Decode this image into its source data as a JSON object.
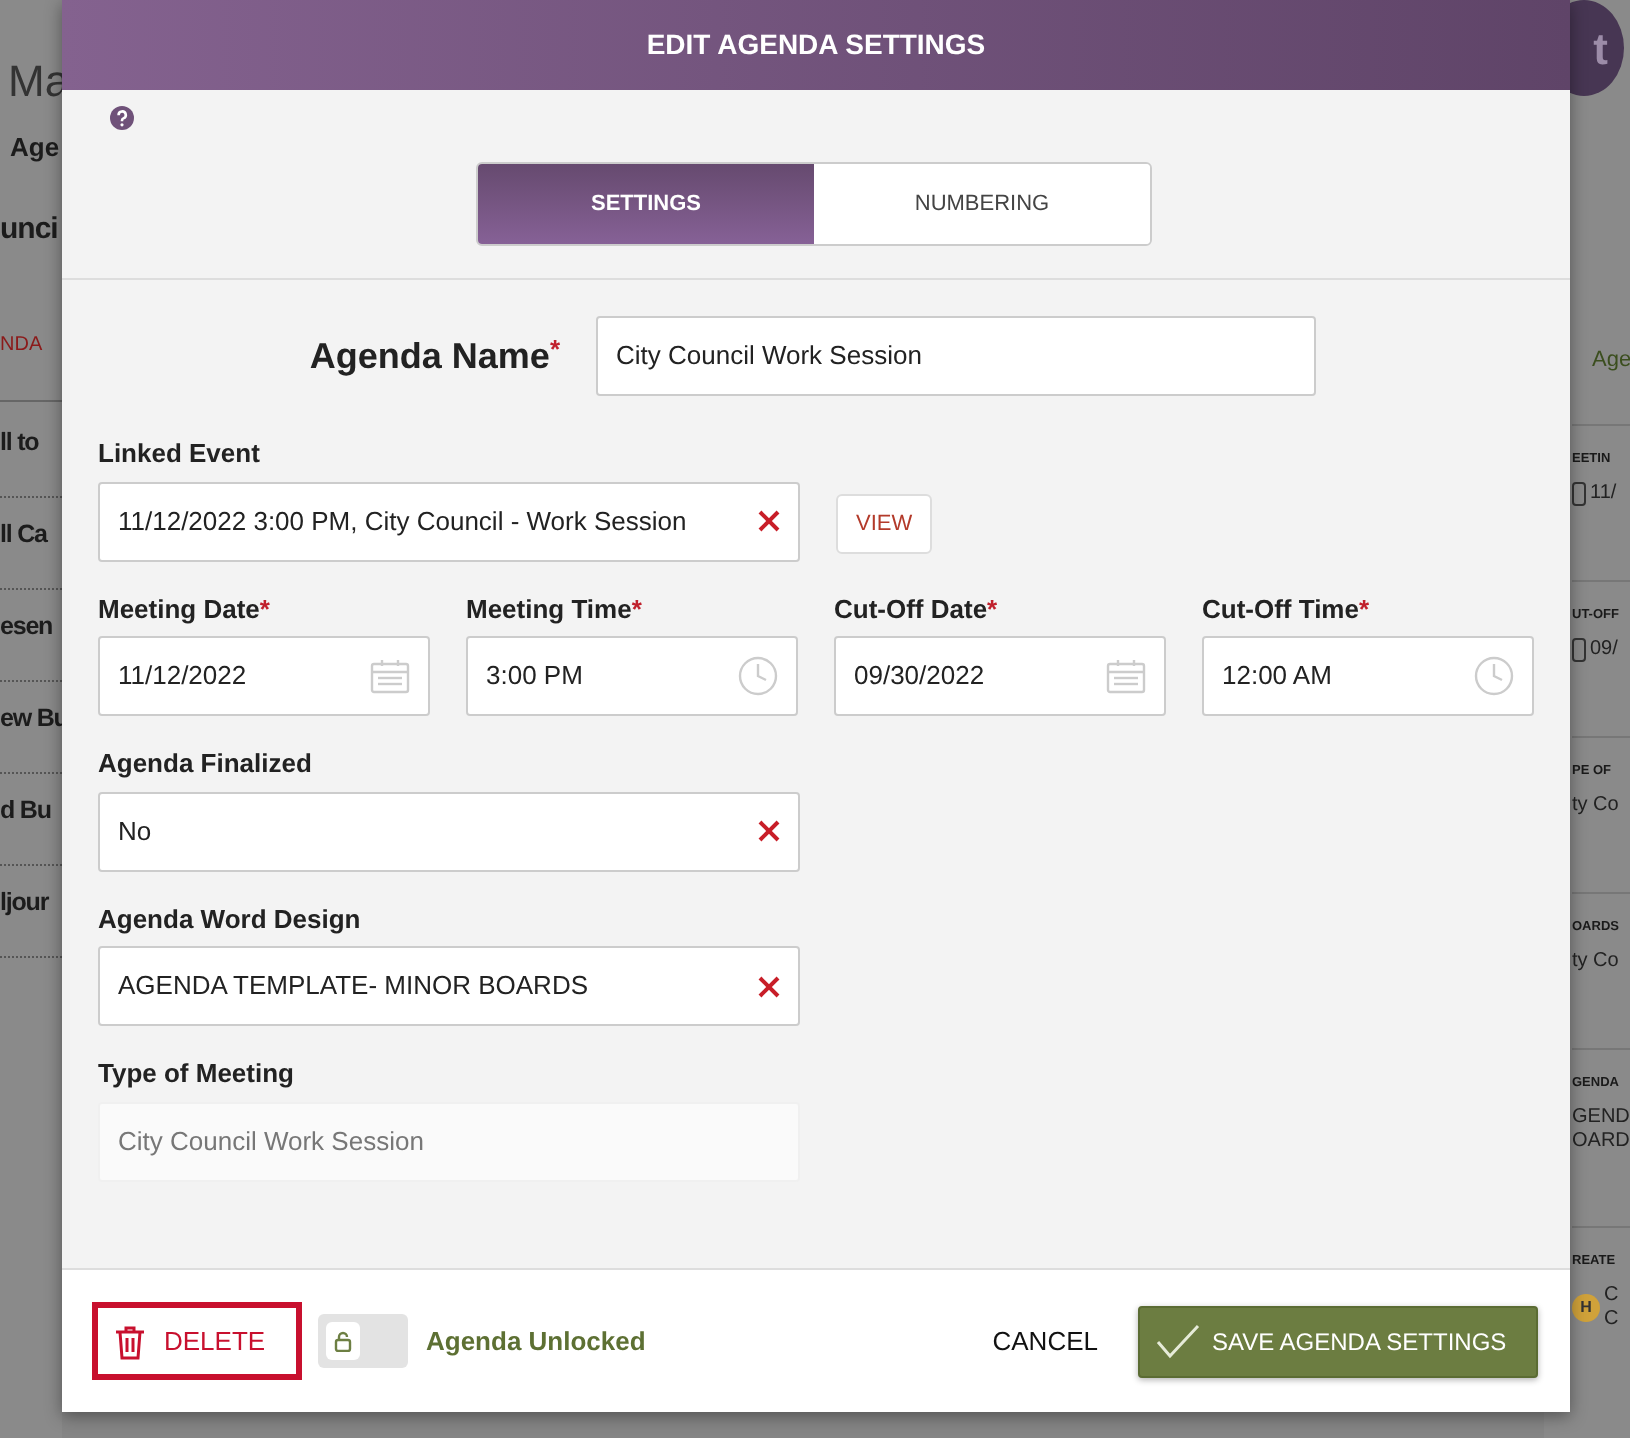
{
  "background_page": {
    "left_texts": [
      {
        "text": "Ma",
        "kind": "title"
      },
      {
        "text": "Age",
        "kind": "tab"
      },
      {
        "text": "unci",
        "kind": "heading"
      },
      {
        "text": "NDA",
        "kind": "link"
      },
      {
        "text": "ll to",
        "kind": "item"
      },
      {
        "text": "ll Ca",
        "kind": "item"
      },
      {
        "text": "esen",
        "kind": "item"
      },
      {
        "text": "ew Bu",
        "kind": "item"
      },
      {
        "text": "d Bu",
        "kind": "item"
      },
      {
        "text": "ljour",
        "kind": "item"
      }
    ],
    "right_button": "t",
    "right_tab": "Age",
    "right_sections": [
      {
        "label": "EETIN",
        "value": "11/",
        "kind": "date"
      },
      {
        "label": "UT-OFF",
        "value": "09/",
        "kind": "date"
      },
      {
        "label": "PE OF",
        "value": "ty Co",
        "kind": "plain"
      },
      {
        "label": "OARDS",
        "value": "ty Co",
        "kind": "plain"
      },
      {
        "label": "GENDA",
        "value": "GEND\nOARD",
        "kind": "plain"
      },
      {
        "label": "REATE",
        "value": "C\nC",
        "kind": "person",
        "avatar_text": "H"
      }
    ]
  },
  "dialog": {
    "title": "EDIT AGENDA SETTINGS",
    "tabs": [
      {
        "label": "SETTINGS",
        "selected": true
      },
      {
        "label": "NUMBERING",
        "selected": false
      }
    ],
    "agenda_name": {
      "label": "Agenda Name",
      "required_mark": "*",
      "value": "City Council Work Session"
    },
    "linked_event": {
      "label": "Linked Event",
      "value": "11/12/2022 3:00 PM, City Council - Work Session",
      "view_button": "VIEW"
    },
    "schedule_fields": [
      {
        "label": "Meeting Date",
        "required_mark": "*",
        "value": "11/12/2022",
        "kind": "date"
      },
      {
        "label": "Meeting Time",
        "required_mark": "*",
        "value": "3:00 PM",
        "kind": "time"
      },
      {
        "label": "Cut-Off Date",
        "required_mark": "*",
        "value": "09/30/2022",
        "kind": "date"
      },
      {
        "label": "Cut-Off Time",
        "required_mark": "*",
        "value": "12:00 AM",
        "kind": "time"
      }
    ],
    "select_fields": [
      {
        "label": "Agenda Finalized",
        "value": "No"
      },
      {
        "label": "Agenda Word Design",
        "value": "AGENDA TEMPLATE- MINOR BOARDS"
      }
    ],
    "type_of_meeting": {
      "label": "Type of Meeting",
      "placeholder": "City Council Work Session"
    },
    "footer": {
      "delete_button": "DELETE",
      "locked": false,
      "lock_label": "Agenda Unlocked",
      "cancel_button": "CANCEL",
      "save_button": "SAVE AGENDA SETTINGS"
    }
  }
}
